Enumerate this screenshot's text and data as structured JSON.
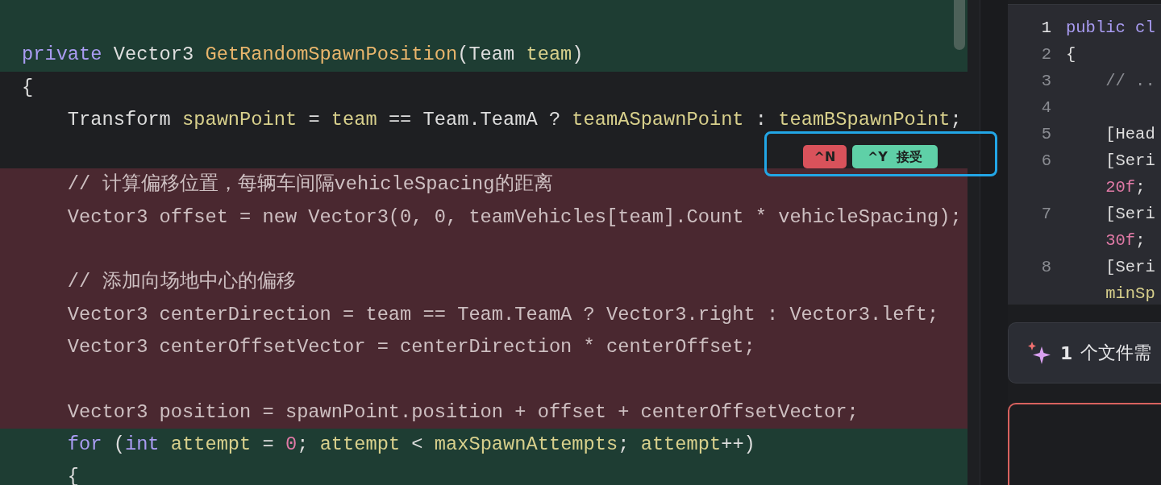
{
  "editor": {
    "lines": [
      {
        "kind": "added"
      },
      {
        "kind": "added",
        "tokens": [
          {
            "text": "private ",
            "kind": "kw"
          },
          {
            "text": "Vector3 ",
            "kind": "plain"
          },
          {
            "text": "GetRandomSpawnPosition",
            "kind": "fn"
          },
          {
            "text": "(Team ",
            "kind": "plain"
          },
          {
            "text": "team",
            "kind": "var"
          },
          {
            "text": ")",
            "kind": "plain"
          }
        ]
      },
      {
        "kind": "current",
        "tokens": [
          {
            "text": "{",
            "kind": "plain"
          }
        ]
      },
      {
        "kind": "current",
        "tokens": [
          {
            "text": "    Transform ",
            "kind": "plain"
          },
          {
            "text": "spawnPoint",
            "kind": "var"
          },
          {
            "text": " = ",
            "kind": "plain"
          },
          {
            "text": "team",
            "kind": "var"
          },
          {
            "text": " == Team.TeamA ? ",
            "kind": "plain"
          },
          {
            "text": "teamASpawnPoint",
            "kind": "var"
          },
          {
            "text": " : ",
            "kind": "plain"
          },
          {
            "text": "teamBSpawnPoint",
            "kind": "var"
          },
          {
            "text": ";",
            "kind": "plain"
          }
        ]
      },
      {
        "kind": "current"
      },
      {
        "kind": "removed",
        "tokens": [
          {
            "text": "    // 计算偏移位置，每辆车间隔vehicleSpacing的距离",
            "kind": "plain"
          }
        ]
      },
      {
        "kind": "removed",
        "tokens": [
          {
            "text": "    Vector3 offset = new Vector3(0, 0, teamVehicles[team].Count * vehicleSpacing);",
            "kind": "plain"
          }
        ]
      },
      {
        "kind": "removed"
      },
      {
        "kind": "removed",
        "tokens": [
          {
            "text": "    // 添加向场地中心的偏移",
            "kind": "plain"
          }
        ]
      },
      {
        "kind": "removed",
        "tokens": [
          {
            "text": "    Vector3 centerDirection = team == Team.TeamA ? Vector3.right : Vector3.left;",
            "kind": "plain"
          }
        ]
      },
      {
        "kind": "removed",
        "tokens": [
          {
            "text": "    Vector3 centerOffsetVector = centerDirection * centerOffset;",
            "kind": "plain"
          }
        ]
      },
      {
        "kind": "removed"
      },
      {
        "kind": "removed",
        "tokens": [
          {
            "text": "    Vector3 position = spawnPoint.position + offset + centerOffsetVector;",
            "kind": "plain"
          }
        ]
      },
      {
        "kind": "added",
        "tokens": [
          {
            "text": "    for ",
            "kind": "kw"
          },
          {
            "text": "(",
            "kind": "plain"
          },
          {
            "text": "int ",
            "kind": "kw"
          },
          {
            "text": "attempt",
            "kind": "var"
          },
          {
            "text": " = ",
            "kind": "plain"
          },
          {
            "text": "0",
            "kind": "num"
          },
          {
            "text": "; ",
            "kind": "plain"
          },
          {
            "text": "attempt",
            "kind": "var"
          },
          {
            "text": " < ",
            "kind": "plain"
          },
          {
            "text": "maxSpawnAttempts",
            "kind": "var"
          },
          {
            "text": "; ",
            "kind": "plain"
          },
          {
            "text": "attempt",
            "kind": "var"
          },
          {
            "text": "++)",
            "kind": "plain"
          }
        ]
      },
      {
        "kind": "added",
        "tokens": [
          {
            "text": "    {",
            "kind": "plain"
          }
        ]
      }
    ]
  },
  "diff_actions": [
    {
      "kind": "reject",
      "key": "^N"
    },
    {
      "kind": "accept",
      "key": "^Y",
      "label": "接受"
    }
  ],
  "preview": {
    "lines": [
      {
        "number": "1",
        "selected": true,
        "tokens": [
          {
            "text": "public cl",
            "kind": "kw"
          }
        ]
      },
      {
        "number": "2",
        "selected": false,
        "tokens": [
          {
            "text": "{",
            "kind": "plain"
          }
        ]
      },
      {
        "number": "3",
        "selected": false,
        "tokens": [
          {
            "text": "    // ..",
            "kind": "comment"
          }
        ]
      },
      {
        "number": "4",
        "selected": false
      },
      {
        "number": "5",
        "selected": false,
        "tokens": [
          {
            "text": "    [Head",
            "kind": "plain"
          }
        ]
      },
      {
        "number": "6",
        "selected": false,
        "tokens": [
          {
            "text": "    [Seri",
            "kind": "plain"
          }
        ],
        "wrap": [
          {
            "text": "    20f",
            "kind": "num"
          },
          {
            "text": ";",
            "kind": "plain"
          }
        ]
      },
      {
        "number": "7",
        "selected": false,
        "tokens": [
          {
            "text": "    [Seri",
            "kind": "plain"
          }
        ],
        "wrap": [
          {
            "text": "    30f",
            "kind": "num"
          },
          {
            "text": ";",
            "kind": "plain"
          }
        ]
      },
      {
        "number": "8",
        "selected": false,
        "tokens": [
          {
            "text": "    [Seri",
            "kind": "plain"
          }
        ],
        "wrap": [
          {
            "text": "    minSp",
            "kind": "var"
          }
        ]
      }
    ]
  },
  "summary": {
    "count": "1",
    "text": "个文件需"
  }
}
